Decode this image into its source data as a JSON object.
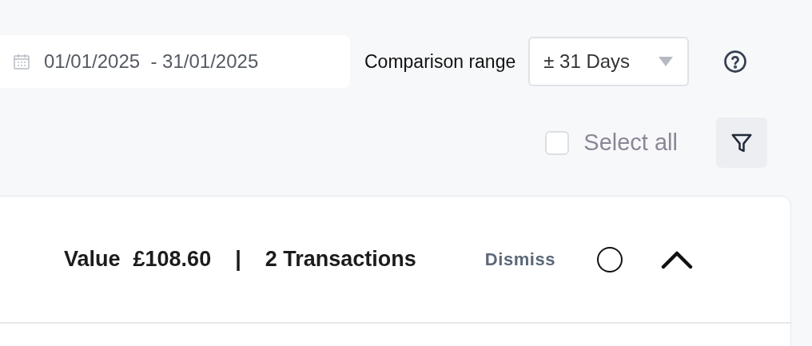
{
  "date_range": {
    "value": "01/01/2025  - 31/01/2025"
  },
  "comparison": {
    "label": "Comparison range",
    "value": "± 31 Days"
  },
  "select_all": {
    "label": "Select all",
    "checked": false
  },
  "summary": {
    "value_label": "Value",
    "value": "£108.60",
    "separator": "|",
    "transactions": "2 Transactions",
    "dismiss": "Dismiss",
    "selected": false,
    "expanded": true
  }
}
